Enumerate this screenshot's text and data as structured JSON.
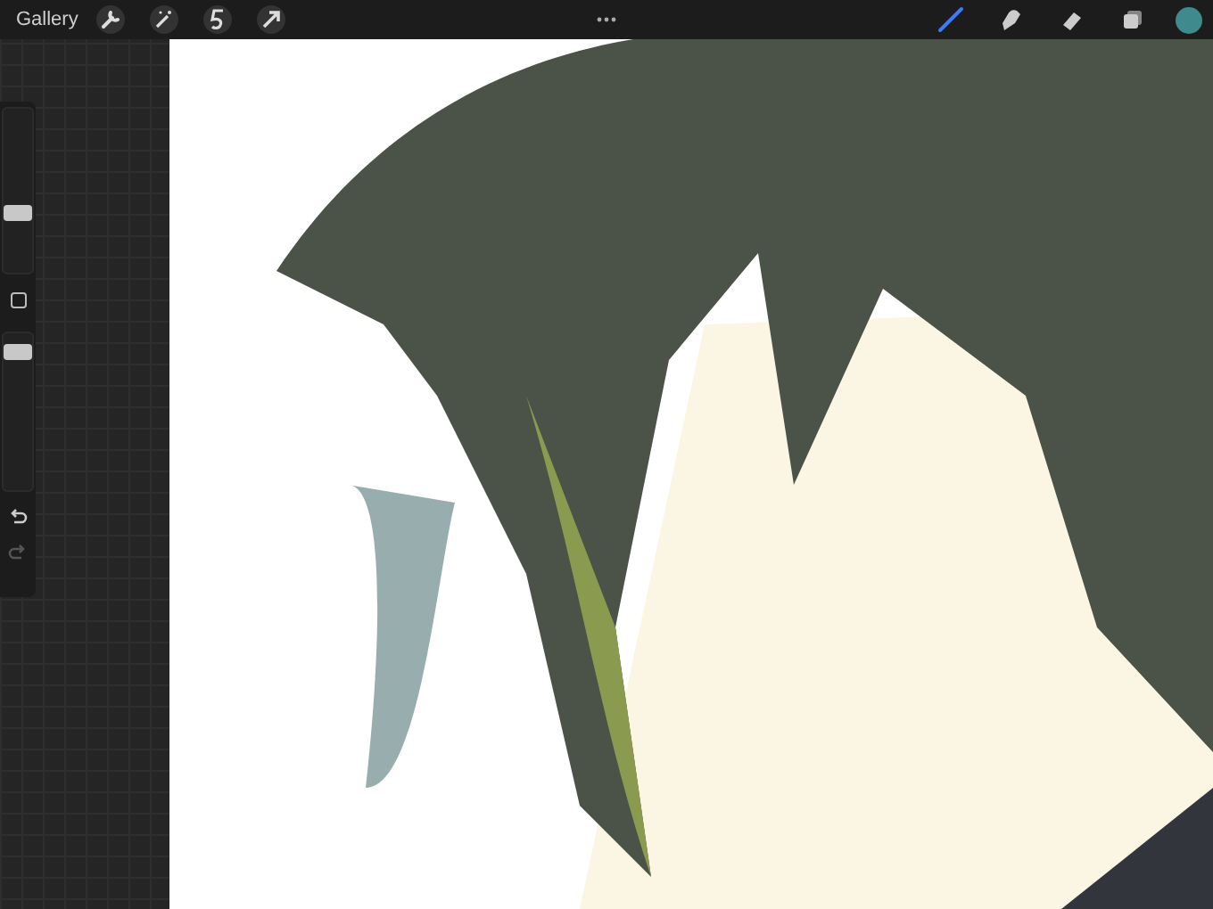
{
  "top_bar": {
    "gallery": "Gallery",
    "actions": [
      {
        "kind": "wrench"
      },
      {
        "kind": "wand"
      },
      {
        "kind": "selection"
      },
      {
        "kind": "transform"
      }
    ],
    "tools": [
      {
        "kind": "brush",
        "selected": true
      },
      {
        "kind": "smudge",
        "selected": false
      },
      {
        "kind": "eraser",
        "selected": false
      },
      {
        "kind": "layers",
        "selected": false
      }
    ],
    "color": "#3e8a8c"
  },
  "sidebar": {
    "brush_size": {
      "level": 0.35
    },
    "opacity": {
      "level": 0.92
    },
    "undo": {
      "disabled": false
    },
    "redo": {
      "disabled": true
    }
  }
}
